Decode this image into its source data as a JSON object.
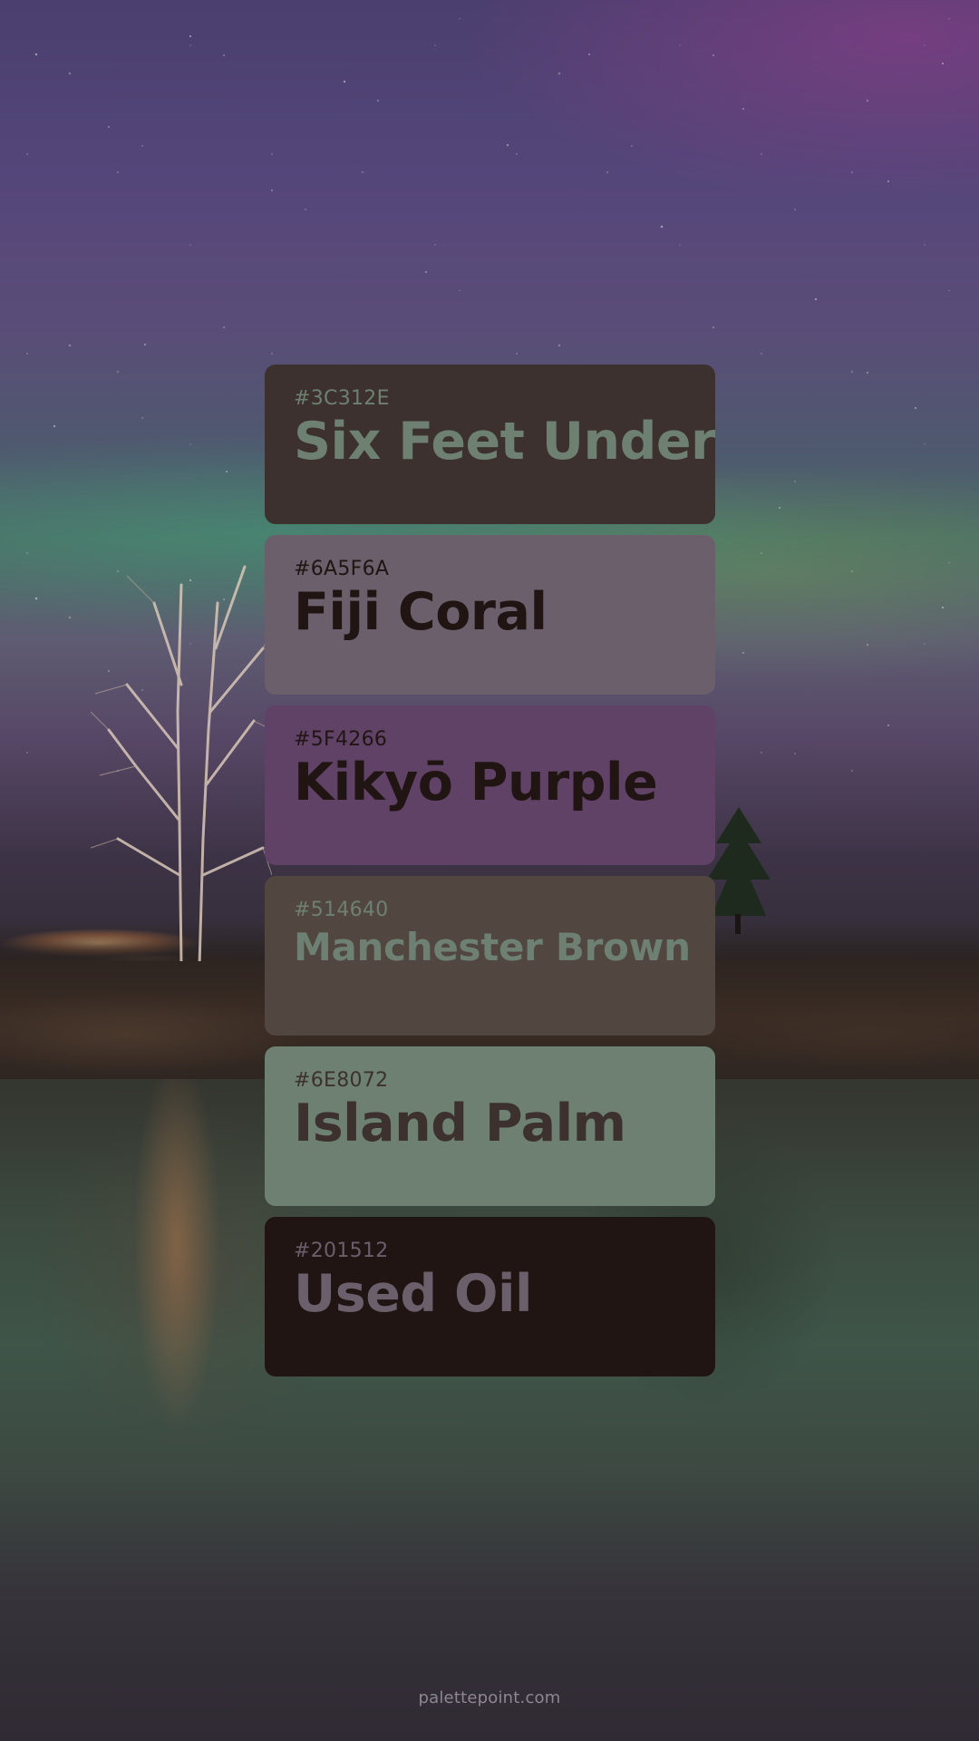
{
  "swatches": [
    {
      "hex": "#3C312E",
      "name": "Six Feet Under",
      "text_color": "#6E8072"
    },
    {
      "hex": "#6A5F6A",
      "name": "Fiji Coral",
      "text_color": "#201512"
    },
    {
      "hex": "#5F4266",
      "name": "Kikyō Purple",
      "text_color": "#201512"
    },
    {
      "hex": "#514640",
      "name": "Manchester Brown",
      "text_color": "#6E8072"
    },
    {
      "hex": "#6E8072",
      "name": "Island Palm",
      "text_color": "#3C312E"
    },
    {
      "hex": "#201512",
      "name": "Used Oil",
      "text_color": "#6A5F6A"
    }
  ],
  "footer": {
    "site": "palettepoint.com"
  }
}
